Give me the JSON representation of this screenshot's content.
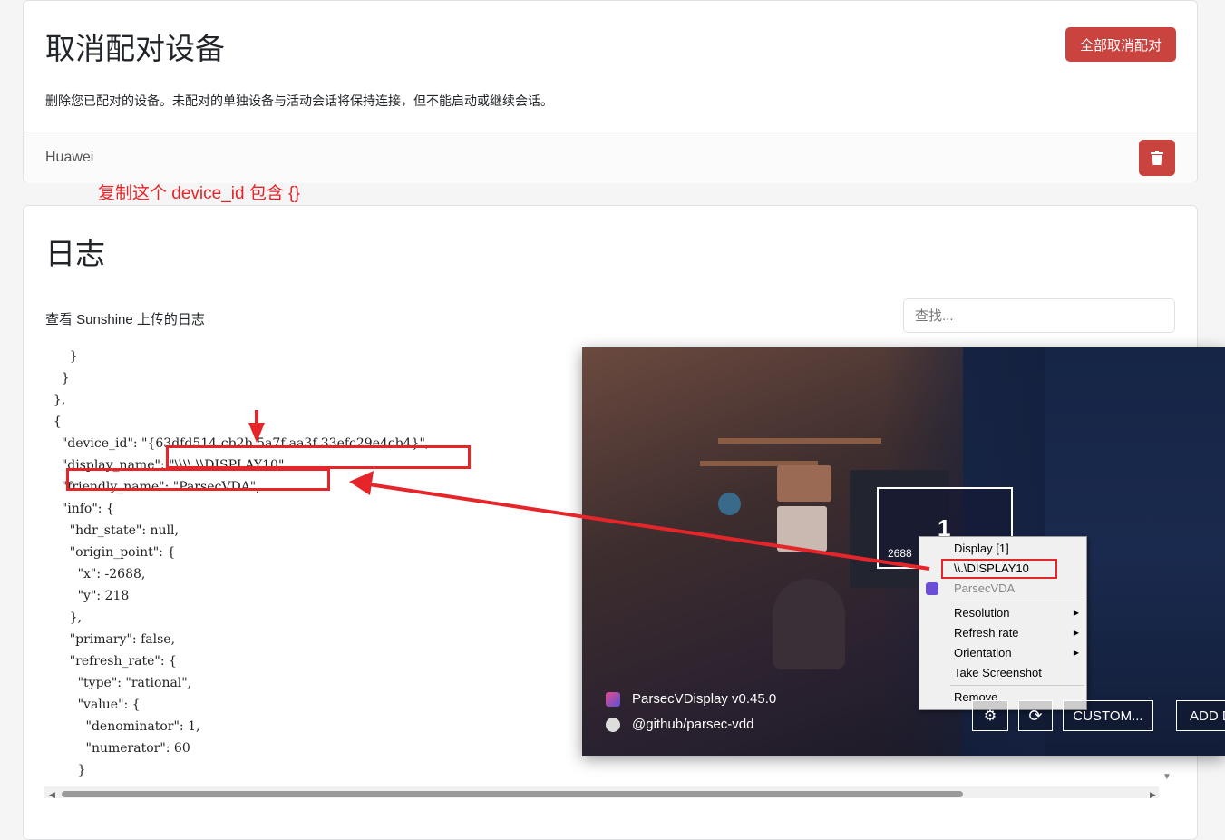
{
  "unpair": {
    "title": "取消配对设备",
    "unpair_all_label": "全部取消配对",
    "description": "删除您已配对的设备。未配对的单独设备与活动会话将保持连接，但不能启动或继续会话。",
    "devices": [
      {
        "name": "Huawei"
      }
    ]
  },
  "logs": {
    "title": "日志",
    "description": "查看 Sunshine 上传的日志",
    "search_placeholder": "查找...",
    "lines": [
      "      ,",
      "      }",
      "    }",
      "  },",
      "  {",
      "    \"device_id\": \"{63dfd514-cb2b-5a7f-aa3f-33efc29e4cb4}\",",
      "    \"display_name\": \"\\\\\\\\.\\\\DISPLAY10\",",
      "    \"friendly_name\": \"ParsecVDA\",",
      "    \"info\": {",
      "      \"hdr_state\": null,",
      "      \"origin_point\": {",
      "        \"x\": -2688,",
      "        \"y\": 218",
      "      },",
      "      \"primary\": false,",
      "      \"refresh_rate\": {",
      "        \"type\": \"rational\",",
      "        \"value\": {",
      "          \"denominator\": 1,",
      "          \"numerator\": 60",
      "        }"
    ],
    "annotation": "复制这个 device_id 包含 {}"
  },
  "overlay": {
    "monitor_number": "1",
    "monitor_resolution": "2688",
    "menu": {
      "items": [
        "Display [1]",
        "\\\\.\\DISPLAY10",
        "ParsecVDA",
        "Resolution",
        "Refresh rate",
        "Orientation",
        "Take Screenshot",
        "Remove"
      ]
    },
    "footer_title": "ParsecVDisplay v0.45.0",
    "footer_github": "@github/parsec-vdd",
    "custom_label": "CUSTOM...",
    "add_label": "ADD D"
  },
  "colors": {
    "accent_red": "#c9433f",
    "annotation_red": "#e5252a"
  }
}
